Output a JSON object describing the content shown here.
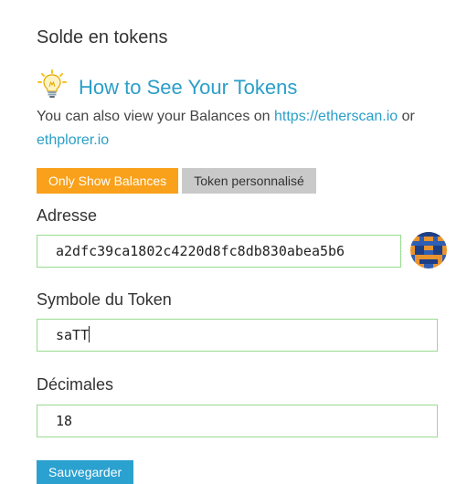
{
  "section": {
    "title": "Solde en tokens"
  },
  "howto": {
    "title": "How to See Your Tokens",
    "icon": "lightbulb-icon"
  },
  "description": {
    "text_before": "You can also view your Balances on ",
    "link1": "https://etherscan.io",
    "text_middle": " or ",
    "link2": "ethplorer.io"
  },
  "tabs": [
    {
      "label": "Only Show Balances",
      "active": true,
      "color": "#f9a11b"
    },
    {
      "label": "Token personnalisé",
      "active": false,
      "color": "#c9c9c9"
    }
  ],
  "form": {
    "address": {
      "label": "Adresse",
      "value": "a2dfc39ca1802c4220d8fc8db830abea5b6"
    },
    "symbol": {
      "label": "Symbole du Token",
      "value": "saTT"
    },
    "decimals": {
      "label": "Décimales",
      "value": "18"
    }
  },
  "actions": {
    "save_label": "Sauvegarder"
  },
  "colors": {
    "accent": "#2a9fc8",
    "field_border": "#98dc8f",
    "button": "#2ba1d0"
  }
}
